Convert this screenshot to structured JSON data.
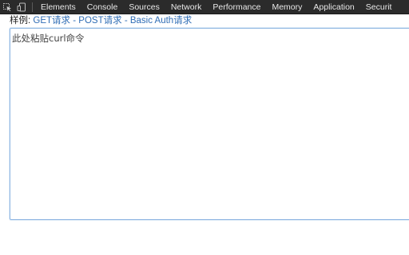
{
  "devtools": {
    "tabs": [
      "Elements",
      "Console",
      "Sources",
      "Network",
      "Performance",
      "Memory",
      "Application",
      "Securit"
    ],
    "icons": [
      "inspect-element-icon",
      "device-toolbar-icon"
    ],
    "colors": {
      "toolbar_bg": "#2b2b2b",
      "tab_text": "#e8e8e8"
    }
  },
  "samples": {
    "prefix": "样例:",
    "links": [
      "GET请求",
      "POST请求",
      "Basic Auth请求"
    ],
    "separator": "-",
    "link_color": "#2f6db5"
  },
  "input": {
    "placeholder": "此处粘贴curl命令",
    "value": ""
  }
}
